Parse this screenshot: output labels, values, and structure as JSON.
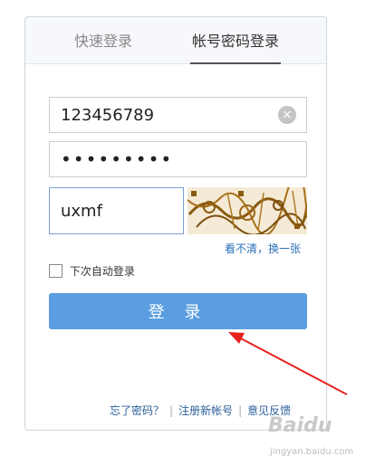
{
  "tabs": {
    "quick_login": "快速登录",
    "account_login": "帐号密码登录"
  },
  "form": {
    "username_value": "123456789",
    "password_value": "•••••••••",
    "captcha_value": "uxmf",
    "clear_icon": "×",
    "refresh_label": "看不清，换一张",
    "auto_login_label": "下次自动登录",
    "login_button": "登 录"
  },
  "footer": {
    "forgot_password": "忘了密码？",
    "register": "注册新帐号",
    "feedback": "意见反馈",
    "separator": "|"
  },
  "watermark": {
    "logo": "Baidu",
    "domain": "jingyan.baidu.com"
  },
  "colors": {
    "login_button": "#5a9de0",
    "link": "#2b6fb8",
    "arrow": "#e8231f"
  }
}
